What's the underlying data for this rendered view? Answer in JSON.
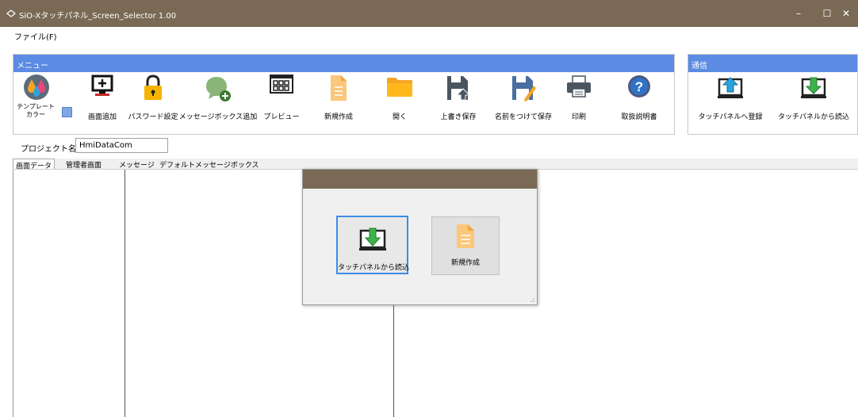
{
  "window": {
    "title": "SiO-Xタッチパネル_Screen_Selector 1.00",
    "minimize": "–",
    "maximize": "☐",
    "close": "✕"
  },
  "menubar": {
    "file": "ファイル(F)"
  },
  "menu_group": {
    "header": "メニュー",
    "items": [
      {
        "label": "テンプレート\nカラー",
        "icon": "palette-icon"
      },
      {
        "label": "画面追加",
        "icon": "add-screen-icon"
      },
      {
        "label": "パスワード設定",
        "icon": "lock-icon"
      },
      {
        "label": "メッセージボックス追加",
        "icon": "add-message-icon"
      },
      {
        "label": "プレビュー",
        "icon": "preview-grid-icon"
      },
      {
        "label": "新規作成",
        "icon": "new-document-icon"
      },
      {
        "label": "開く",
        "icon": "folder-icon"
      },
      {
        "label": "上書き保存",
        "icon": "save-overwrite-icon"
      },
      {
        "label": "名前をつけて保存",
        "icon": "save-as-icon"
      },
      {
        "label": "印刷",
        "icon": "printer-icon"
      },
      {
        "label": "取扱説明書",
        "icon": "help-icon"
      }
    ],
    "template_color_line1": "テンプレート",
    "template_color_line2": "カラー",
    "swatch_color": "#7ea7e8"
  },
  "comm_group": {
    "header": "通信",
    "upload_label": "タッチパネルへ登録",
    "download_label": "タッチパネルから読込"
  },
  "project": {
    "label": "プロジェクト名",
    "value": "HmiDataCom"
  },
  "tabs": [
    "画面データ",
    "管理者画面",
    "メッセージ",
    "デフォルトメッセージボックス"
  ],
  "dialog": {
    "load_label": "タッチパネルから読込",
    "new_label": "新規作成"
  },
  "colors": {
    "titlebar": "#7a6a55",
    "group_header": "#5b8be3",
    "accent_green": "#3cb44a"
  }
}
